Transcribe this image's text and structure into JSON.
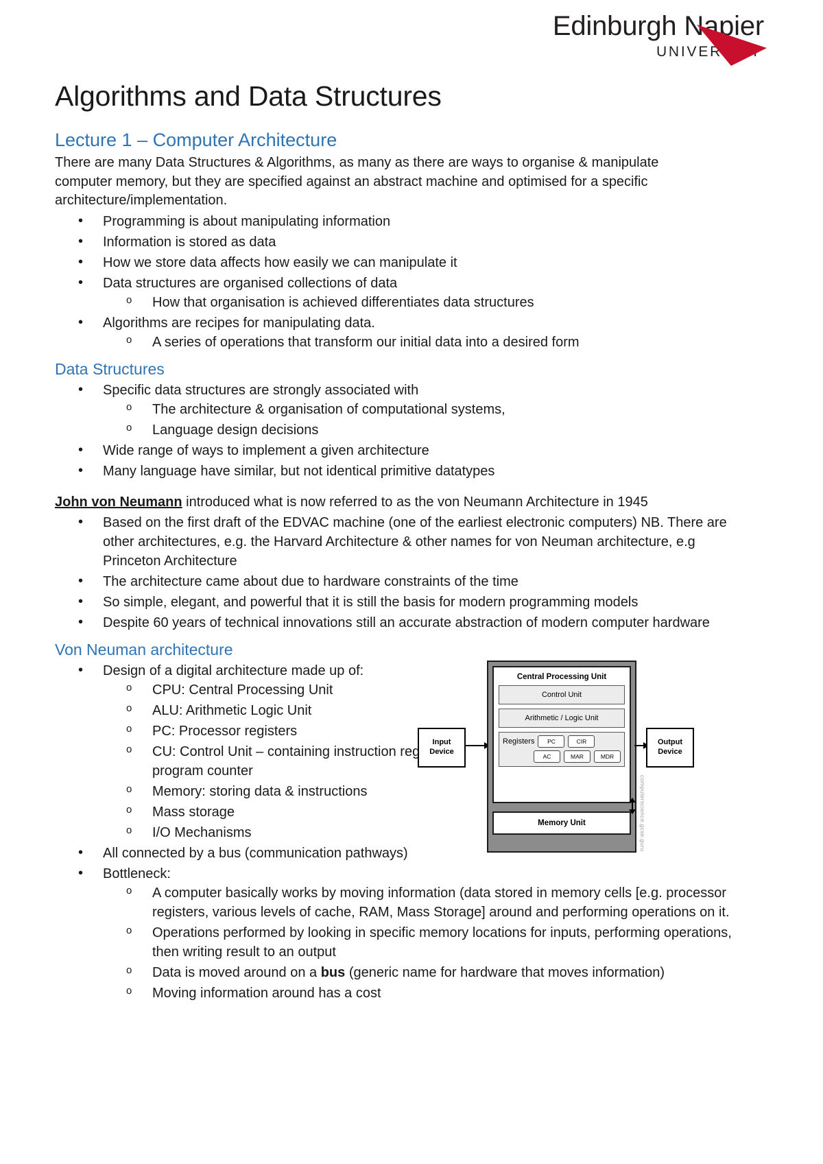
{
  "logo": {
    "name": "Edinburgh Napier",
    "subtitle": "UNIVERSITY",
    "chevron_color": "#C8102E"
  },
  "doc": {
    "title": "Algorithms and Data Structures",
    "heading_color": "#2E74B5"
  },
  "sections": {
    "lecture": {
      "heading": "Lecture 1 – Computer Architecture",
      "intro": "There are many Data Structures & Algorithms, as many as there are ways to organise & manipulate computer memory, but they are specified against an abstract machine and optimised for a specific architecture/implementation.",
      "bullets": [
        "Programming is about manipulating information",
        "Information is stored as data",
        "How we store data affects how easily we can manipulate it",
        "Data structures are organised collections of data",
        "Algorithms are recipes for manipulating data."
      ],
      "sub_after_data_structures": "How that organisation is achieved differentiates data structures",
      "sub_after_algorithms": "A series of operations that transform our initial data into a desired form"
    },
    "data_structures": {
      "heading": "Data Structures",
      "b1": "Specific data structures are strongly associated with",
      "b1_subs": [
        "The architecture & organisation of computational systems,",
        "Language design decisions"
      ],
      "b2": "Wide range of ways to implement a given architecture",
      "b3": "Many language have similar, but not identical primitive datatypes"
    },
    "von_neumann_intro": {
      "bold_name": "John von Neumann",
      "rest": " introduced what is now referred to as the von Neumann Architecture in 1945",
      "bullets": [
        "Based on the first draft of the EDVAC machine (one of the earliest electronic computers) NB. There are other architectures, e.g. the Harvard Architecture & other names for von Neuman architecture, e.g Princeton Architecture",
        "The architecture came about due to hardware constraints of the time",
        "So simple, elegant, and powerful that it is still the basis for modern programming models",
        "Despite 60 years of technical innovations still an accurate abstraction of modern computer hardware"
      ]
    },
    "von_neuman_arch": {
      "heading": "Von Neuman architecture",
      "design_bullet": "Design of a digital architecture made up of:",
      "design_subs": [
        "CPU: Central Processing Unit",
        "ALU: Arithmetic Logic Unit",
        "PC: Processor registers",
        "CU: Control Unit – containing instruction register & program counter",
        "Memory: storing data & instructions",
        "Mass storage",
        "I/O Mechanisms"
      ],
      "bus_bullet": "All connected by a bus (communication pathways)",
      "bottleneck_bullet": "Bottleneck:",
      "bottleneck_subs": [
        "A computer basically works by moving information (data stored in memory cells [e.g. processor registers, various levels of cache, RAM, Mass Storage] around and performing operations on it.",
        "Operations performed by looking in specific memory locations for inputs, performing operations, then writing result to an output",
        "Moving information around has a cost"
      ],
      "bus_sub_prefix": "Data is moved around on a ",
      "bus_sub_bold": "bus",
      "bus_sub_suffix": " (generic name for hardware that moves information)"
    }
  },
  "diagram": {
    "input_device_line1": "Input",
    "input_device_line2": "Device",
    "output_device_line1": "Output",
    "output_device_line2": "Device",
    "cpu_title": "Central Processing Unit",
    "control_unit": "Control Unit",
    "alu": "Arithmetic / Logic Unit",
    "registers_label": "Registers",
    "register_chips": [
      "PC",
      "CIR",
      "AC",
      "MAR",
      "MDR"
    ],
    "memory_unit": "Memory Unit",
    "credit": "computerscience.gcse.guru"
  }
}
